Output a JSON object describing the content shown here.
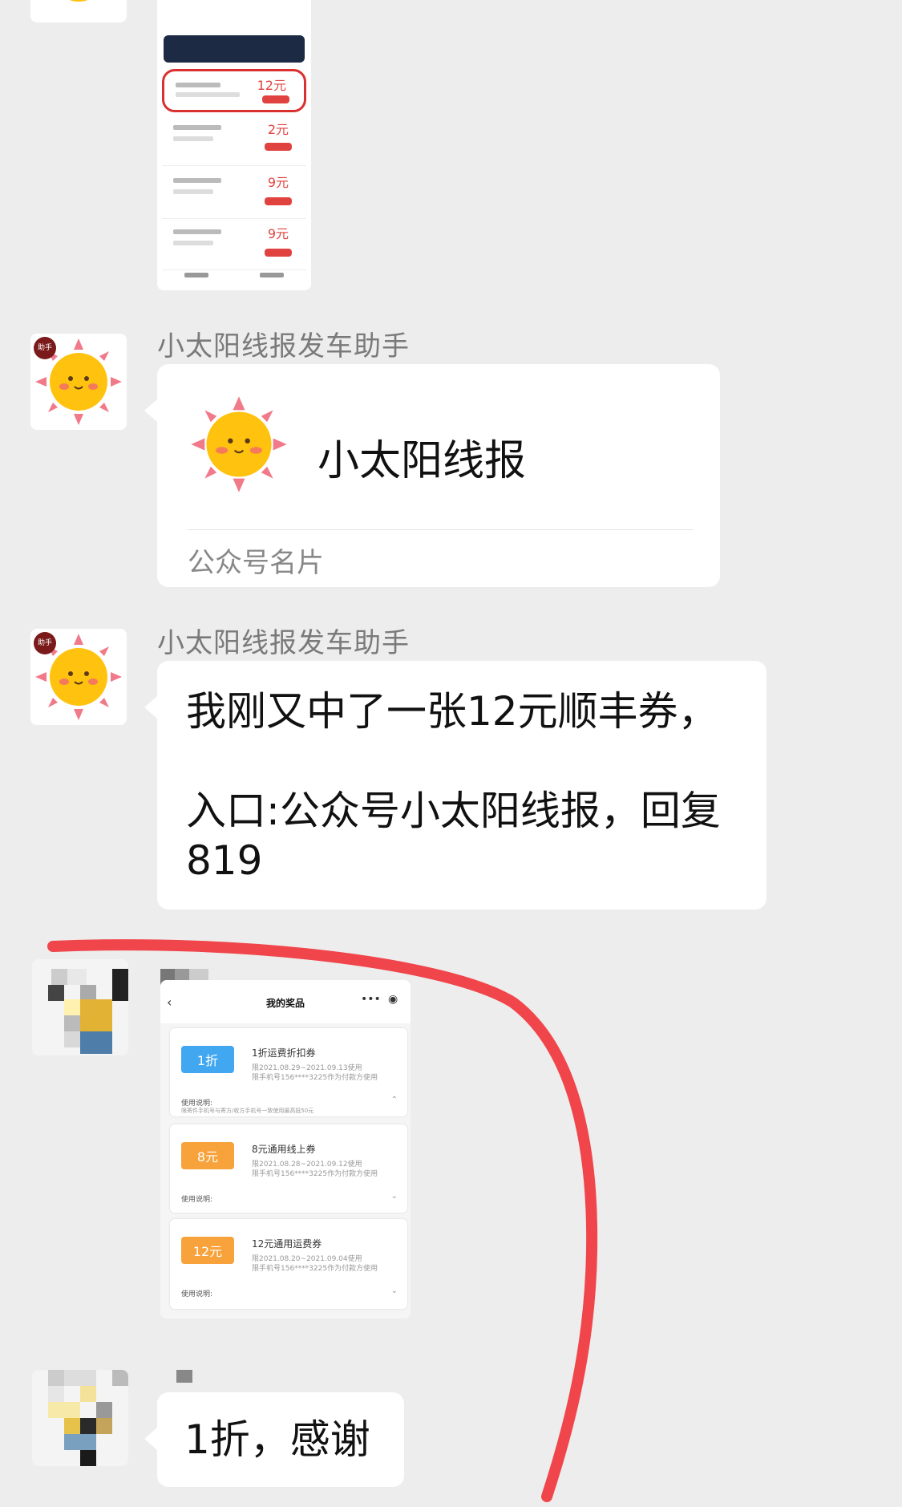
{
  "messages": [
    {
      "sender": "小太阳线报发车助手",
      "type": "card",
      "card_title": "小太阳线报",
      "card_footer": "公众号名片"
    },
    {
      "sender": "小太阳线报发车助手",
      "type": "text",
      "text": "我刚又中了一张12元顺丰券，\n\n入口:公众号小太阳线报，回复819"
    },
    {
      "type": "image",
      "screenshot_title": "我的奖品",
      "prizes": [
        {
          "ticket": "1折",
          "title": "1折运费折扣券",
          "line1": "限2021.08.29~2021.09.13使用",
          "line2": "限手机号156****3225作为付款方使用",
          "use": "使用说明:",
          "note": "限寄件手机号与寄方/收方手机号一致使用最高抵50元"
        },
        {
          "ticket": "8元",
          "title": "8元通用线上券",
          "line1": "限2021.08.28~2021.09.12使用",
          "line2": "限手机号156****3225作为付款方使用",
          "use": "使用说明:"
        },
        {
          "ticket": "12元",
          "title": "12元通用运费券",
          "line1": "限2021.08.20~2021.09.04使用",
          "line2": "限手机号156****3225作为付款方使用",
          "use": "使用说明:"
        }
      ]
    },
    {
      "type": "text",
      "text": "1折，感谢"
    }
  ],
  "top_thumbnail": {
    "prices": [
      "12元",
      "2元",
      "9元",
      "9元"
    ]
  },
  "avatar_badge": "助手",
  "colors": {
    "background": "#ededed",
    "bubble": "#ffffff",
    "annotation": "#f0454b",
    "ticket_blue": "#41a7f1",
    "ticket_orange": "#f7a23b"
  }
}
